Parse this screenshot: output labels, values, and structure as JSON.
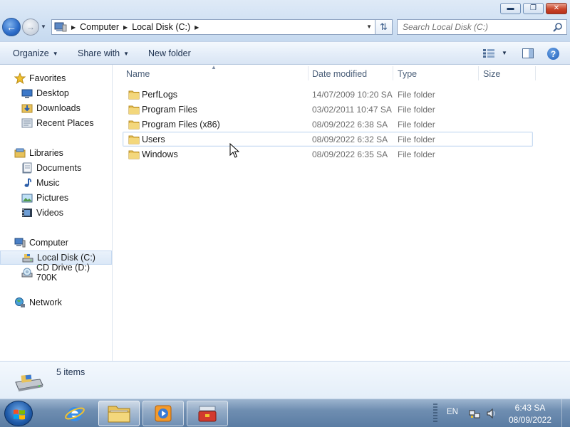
{
  "window": {
    "minimize_glyph": "▬",
    "maximize_glyph": "❐",
    "close_glyph": "✕"
  },
  "address": {
    "crumbs": [
      "Computer",
      "Local Disk (C:)"
    ],
    "search_placeholder": "Search Local Disk (C:)"
  },
  "toolbar": {
    "organize": "Organize",
    "share_with": "Share with",
    "new_folder": "New folder",
    "help_glyph": "?"
  },
  "nav": {
    "favorites": "Favorites",
    "desktop": "Desktop",
    "downloads": "Downloads",
    "recent_places": "Recent Places",
    "libraries": "Libraries",
    "documents": "Documents",
    "music": "Music",
    "pictures": "Pictures",
    "videos": "Videos",
    "computer": "Computer",
    "local_disk": "Local Disk (C:)",
    "cd_drive": "CD Drive (D:) 700K",
    "network": "Network"
  },
  "columns": {
    "name": "Name",
    "date": "Date modified",
    "type": "Type",
    "size": "Size"
  },
  "files": [
    {
      "name": "PerfLogs",
      "date": "14/07/2009 10:20 SA",
      "type": "File folder"
    },
    {
      "name": "Program Files",
      "date": "03/02/2011 10:47 SA",
      "type": "File folder"
    },
    {
      "name": "Program Files (x86)",
      "date": "08/09/2022 6:38 SA",
      "type": "File folder"
    },
    {
      "name": "Users",
      "date": "08/09/2022 6:32 SA",
      "type": "File folder"
    },
    {
      "name": "Windows",
      "date": "08/09/2022 6:35 SA",
      "type": "File folder"
    }
  ],
  "details": {
    "item_count": "5 items"
  },
  "taskbar": {
    "language": "EN",
    "time": "6:43 SA",
    "date": "08/09/2022"
  },
  "colors": {
    "selection_border": "#c9dcf2",
    "taskbar": "#6f8eb1",
    "folder": "#e8c25a"
  }
}
